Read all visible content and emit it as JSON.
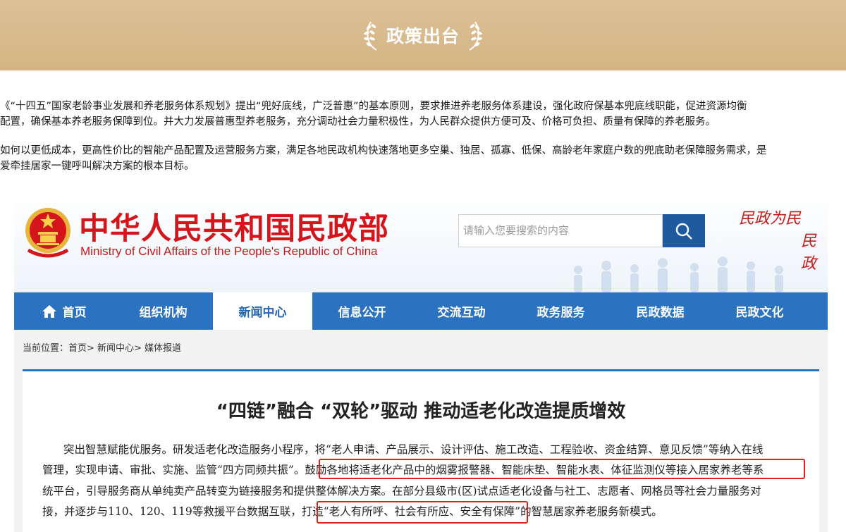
{
  "banner": {
    "title": "政策出台"
  },
  "intro": {
    "p1_line1": "《“十四五”国家老龄事业发展和养老服务体系规划》提出“兜好底线，广泛普惠”的基本原则，要求推进养老服务体系建设，强化政府保基本兜底线职能，促进资源均衡",
    "p1_line2": "配置，确保基本养老服务保障到位。并大力发展普惠型养老服务，充分调动社会力量积极性，为人民群众提供方便可及、价格可负担、质量有保障的养老服务。",
    "p2_line1": "如何以更低成本，更高性价比的智能产品配置及运营服务方案，满足各地民政机构快速落地更多空巢、独居、孤寡、低保、高龄老年家庭户数的兜底助老保障服务需求，是",
    "p2_line2": "爱牵挂居家一键呼叫解决方案的根本目标。"
  },
  "site": {
    "title_cn": "中华人民共和国民政部",
    "title_en": "Ministry of Civil Affairs of the People's Republic of China",
    "search_placeholder": "请输入您要搜索的内容",
    "slogan_line1": "民政为民",
    "slogan_line2": "民政"
  },
  "nav": {
    "items": [
      {
        "label": "首页"
      },
      {
        "label": "组织机构"
      },
      {
        "label": "新闻中心"
      },
      {
        "label": "信息公开"
      },
      {
        "label": "交流互动"
      },
      {
        "label": "政务服务"
      },
      {
        "label": "民政数据"
      },
      {
        "label": "民政文化"
      }
    ],
    "active": "新闻中心"
  },
  "breadcrumb": "当前位置：首页> 新闻中心> 媒体报道",
  "article": {
    "title": "“四链”融合 “双轮”驱动 推动适老化改造提质增效",
    "line1": "突出智慧赋能优服务。研发适老化改造服务小程序，将“老人申请、产品展示、设计评估、施工改造、工程验收、资金结算、意见反馈”等纳入在线",
    "line2": "管理，实现申请、审批、实施、监管“四方同频共振”。鼓励各地将适老化产品中的烟雾报警器、智能床垫、智能水表、体征监测仪等接入居家养老等系",
    "line3": "统平台，引导服务商从单纯卖产品转变为链接服务和提供整体解决方案。在部分县级市(区)试点适老化设备与社工、志愿者、网格员等社会力量服务对",
    "line4": "接，并逐步与110、120、119等救援平台数据互联，打造“老人有所呼、社会有所应、安全有保障”的智慧居家养老服务新模式。"
  },
  "colors": {
    "banner": "#d4b483",
    "nav": "#2b72c0",
    "brand_red": "#d4161c",
    "highlight": "#e02020"
  }
}
